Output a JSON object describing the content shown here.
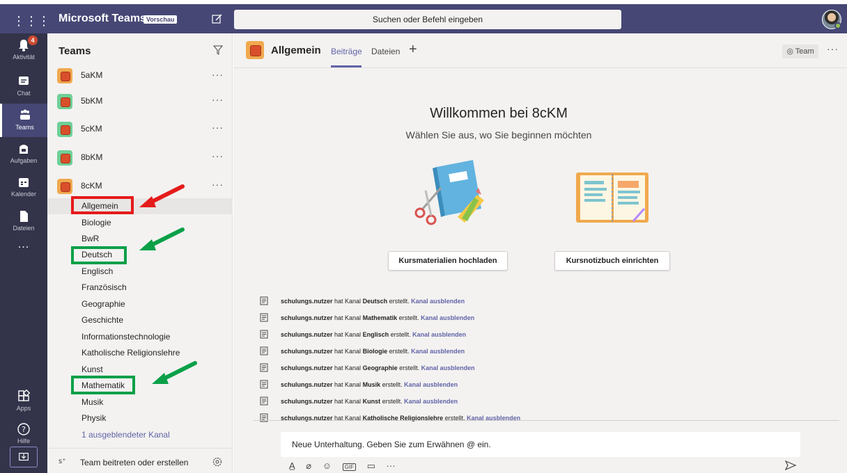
{
  "topbar": {
    "app_title": "Microsoft Teams",
    "badge": "Vorschau",
    "search_placeholder": "Suchen oder Befehl eingeben",
    "bg_color": "#464775"
  },
  "rail": {
    "items": [
      {
        "label": "Aktivität",
        "icon": "bell-icon",
        "badge": "4"
      },
      {
        "label": "Chat",
        "icon": "chat-icon"
      },
      {
        "label": "Teams",
        "icon": "teams-icon",
        "active": true
      },
      {
        "label": "Aufgaben",
        "icon": "assignments-icon"
      },
      {
        "label": "Kalender",
        "icon": "calendar-icon"
      },
      {
        "label": "Dateien",
        "icon": "files-icon"
      }
    ],
    "more": "...",
    "bottom_items": [
      {
        "label": "Apps",
        "icon": "apps-icon"
      },
      {
        "label": "Hilfe",
        "icon": "help-icon"
      }
    ]
  },
  "teams_panel": {
    "header": "Teams",
    "teams": [
      {
        "name": "5aKM",
        "tile_color": "#f0a94e"
      },
      {
        "name": "5bKM",
        "tile_color": "#6fcf97"
      },
      {
        "name": "5cKM",
        "tile_color": "#6fcf97"
      },
      {
        "name": "8bKM",
        "tile_color": "#6fcf97"
      },
      {
        "name": "8cKM",
        "tile_color": "#f0a94e"
      }
    ],
    "channels": [
      {
        "name": "Allgemein",
        "active": true
      },
      {
        "name": "Biologie"
      },
      {
        "name": "BwR"
      },
      {
        "name": "Deutsch"
      },
      {
        "name": "Englisch"
      },
      {
        "name": "Französisch"
      },
      {
        "name": "Geographie"
      },
      {
        "name": "Geschichte"
      },
      {
        "name": "Informationstechnologie"
      },
      {
        "name": "Katholische Religionslehre"
      },
      {
        "name": "Kunst"
      },
      {
        "name": "Mathematik"
      },
      {
        "name": "Musik"
      },
      {
        "name": "Physik"
      },
      {
        "name": "1 ausgeblendeter Kanal",
        "link": true
      }
    ],
    "footer_label": "Team beitreten oder erstellen"
  },
  "main": {
    "channel_title": "Allgemein",
    "tabs": [
      "Beiträge",
      "Dateien"
    ],
    "team_button": "Team",
    "welcome_title": "Willkommen bei 8cKM",
    "welcome_subtitle": "Wählen Sie aus, wo Sie beginnen möchten",
    "action_upload": "Kursmaterialien hochladen",
    "action_notebook": "Kursnotizbuch einrichten",
    "feed": [
      {
        "user": "schulungs.nutzer",
        "pre": "hat Kanal",
        "channel": "Deutsch",
        "post": "erstellt.",
        "link": "Kanal ausblenden"
      },
      {
        "user": "schulungs.nutzer",
        "pre": "hat Kanal",
        "channel": "Mathematik",
        "post": "erstellt.",
        "link": "Kanal ausblenden"
      },
      {
        "user": "schulungs.nutzer",
        "pre": "hat Kanal",
        "channel": "Englisch",
        "post": "erstellt.",
        "link": "Kanal ausblenden"
      },
      {
        "user": "schulungs.nutzer",
        "pre": "hat Kanal",
        "channel": "Biologie",
        "post": "erstellt.",
        "link": "Kanal ausblenden"
      },
      {
        "user": "schulungs.nutzer",
        "pre": "hat Kanal",
        "channel": "Geographie",
        "post": "erstellt.",
        "link": "Kanal ausblenden"
      },
      {
        "user": "schulungs.nutzer",
        "pre": "hat Kanal",
        "channel": "Musik",
        "post": "erstellt.",
        "link": "Kanal ausblenden"
      },
      {
        "user": "schulungs.nutzer",
        "pre": "hat Kanal",
        "channel": "Kunst",
        "post": "erstellt.",
        "link": "Kanal ausblenden"
      },
      {
        "user": "schulungs.nutzer",
        "pre": "hat Kanal",
        "channel": "Katholische Religionslehre",
        "post": "erstellt.",
        "link": "Kanal ausblenden"
      }
    ],
    "compose_placeholder": "Neue Unterhaltung. Geben Sie zum Erwähnen @ ein."
  },
  "colors": {
    "accent": "#6264a7",
    "annotation_red": "#e51b1b",
    "annotation_green": "#0aa048"
  }
}
